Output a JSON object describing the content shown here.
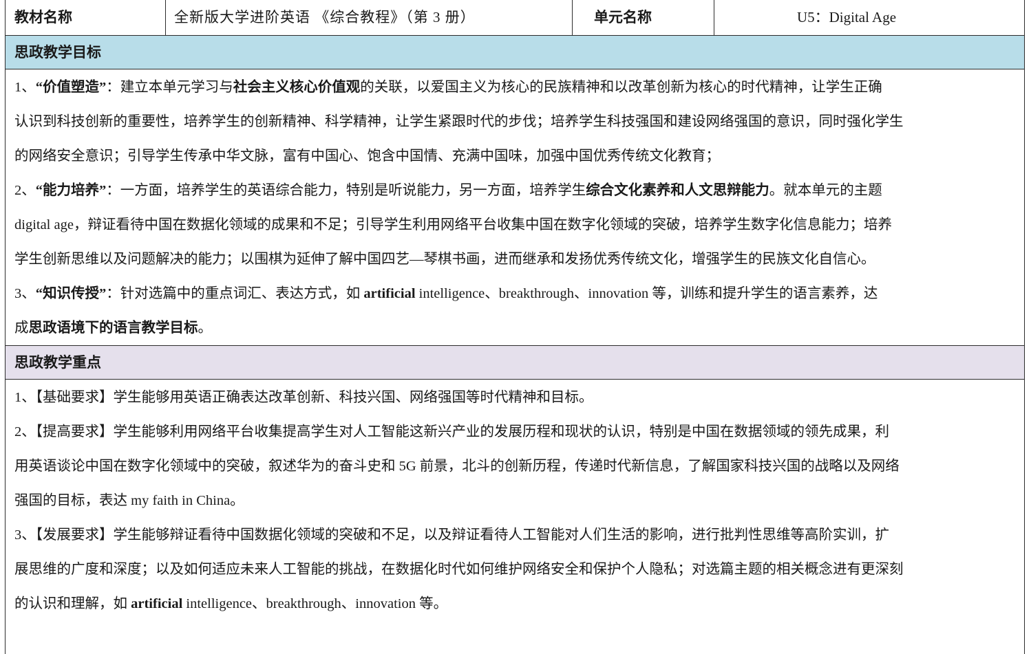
{
  "header": {
    "material_label": "教材名称",
    "material_value": "全新版大学进阶英语 《综合教程》（第 3 册）",
    "unit_label": "单元名称",
    "unit_value": "U5：Digital Age"
  },
  "goals": {
    "title": "思政教学目标",
    "lines": [
      [
        "1、",
        "“价值塑造”",
        "：建立本单元学习与",
        "社会主义核心价值观",
        "的关联，以爱国主义为核心的民族精神和以改革创新为核心的时代精神，让学生正确"
      ],
      [
        "认识到科技创新的重要性，培养学生的创新精神、科学精神，让学生紧跟时代的步伐；培养学生科技强国和建设网络强国的意识，同时强化学生"
      ],
      [
        "的网络安全意识；引导学生传承中华文脉，富有中国心、饱含中国情、充满中国味，加强中国优秀传统文化教育；"
      ],
      [
        "2、",
        "“能力培养”",
        "：一方面，培养学生的英语综合能力，特别是听说能力，另一方面，培养学生",
        "综合文化素养和人文思辩能力",
        "。就本单元的主题"
      ],
      [
        "digital age，辩证看待中国在数据化领域的成果和不足；引导学生利用网络平台收集中国在数字化领域的突破，培养学生数字化信息能力；培养"
      ],
      [
        "学生创新思维以及问题解决的能力；以围棋为延伸了解中国四艺—琴棋书画，进而继承和发扬优秀传统文化，增强学生的民族文化自信心。"
      ],
      [
        "3、",
        "“知识传授”",
        "：针对选篇中的重点词汇、表达方式，如 ",
        "artificial",
        " intelligence、breakthrough、innovation 等，训练和提升学生的语言素养，达"
      ],
      [
        "成",
        "思政语境下的语言教学目标",
        "。"
      ]
    ]
  },
  "focus": {
    "title": "思政教学重点",
    "lines": [
      [
        "1、【基础要求】学生能够用英语正确表达改革创新、科技兴国、网络强国等时代精神和目标。"
      ],
      [
        "2、【提高要求】学生能够利用网络平台收集提高学生对人工智能这新兴产业的发展历程和现状的认识，特别是中国在数据领域的领先成果，利"
      ],
      [
        "用英语谈论中国在数字化领域中的突破，叙述华为的奋斗史和 5G 前景，北斗的创新历程，传递时代新信息，了解国家科技兴国的战略以及网络"
      ],
      [
        "强国的目标，表达 my faith in China。"
      ],
      [
        "3、【发展要求】学生能够辩证看待中国数据化领域的突破和不足，以及辩证看待人工智能对人们生活的影响，进行批判性思维等高阶实训，扩"
      ],
      [
        "展思维的广度和深度；以及如何适应未来人工智能的挑战，在数据化时代如何维护网络安全和保护个人隐私；对选篇主题的相关概念进有更深刻"
      ],
      [
        "的认识和理解，如 ",
        "artificial",
        " intelligence、breakthrough、innovation  等。"
      ]
    ]
  }
}
